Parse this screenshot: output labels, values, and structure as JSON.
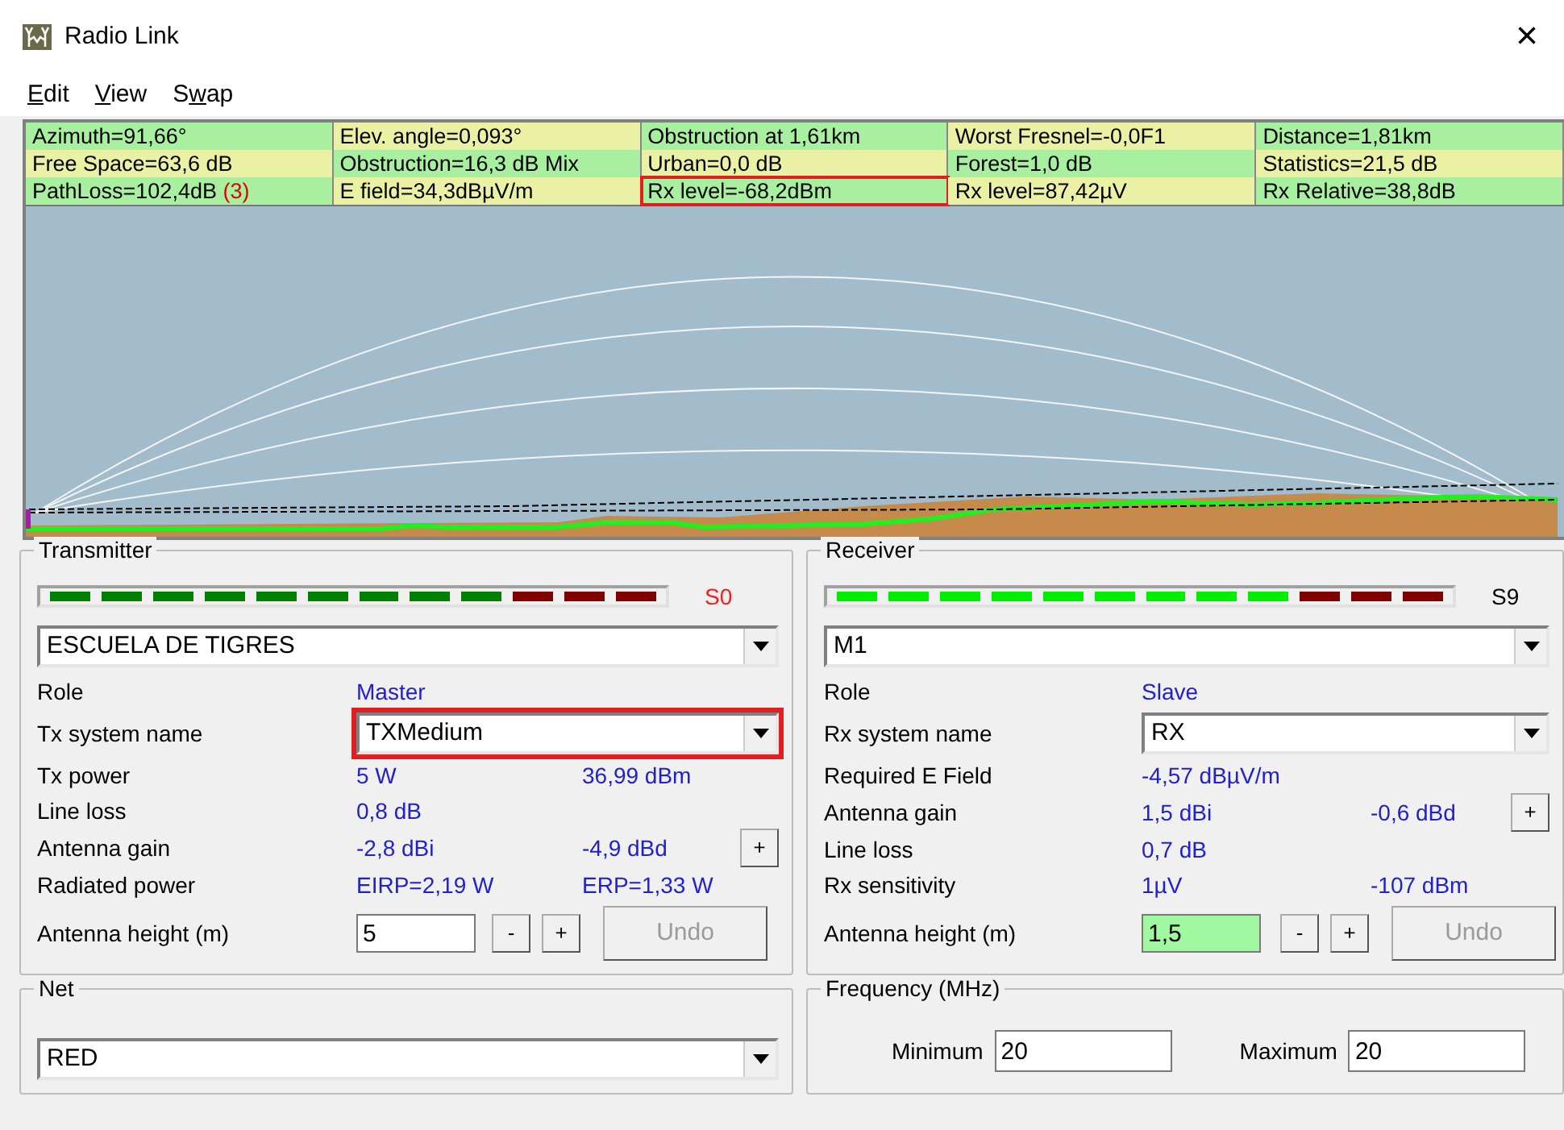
{
  "window": {
    "title": "Radio Link",
    "close": "×"
  },
  "menu": [
    {
      "access_key": "E",
      "rest": "dit"
    },
    {
      "access_key": "V",
      "rest": "iew"
    },
    {
      "before": "S",
      "access_key": "w",
      "rest": "ap"
    }
  ],
  "info": [
    [
      {
        "text": "Azimuth=91,66°",
        "highlighted": false
      },
      {
        "text": "Elev. angle=0,093°",
        "highlighted": false
      },
      {
        "text": "Obstruction at 1,61km",
        "highlighted": false
      },
      {
        "text": "Worst Fresnel=-0,0F1",
        "highlighted": false
      },
      {
        "text": "Distance=1,81km",
        "highlighted": false
      }
    ],
    [
      {
        "text": "Free Space=63,6 dB",
        "highlighted": false
      },
      {
        "text": "Obstruction=16,3 dB Mix",
        "highlighted": false
      },
      {
        "text": "Urban=0,0 dB",
        "highlighted": false
      },
      {
        "text": "Forest=1,0 dB",
        "highlighted": false
      },
      {
        "text": "Statistics=21,5 dB",
        "highlighted": false
      }
    ],
    [
      {
        "text": "PathLoss=102,4dB",
        "note": "(3)",
        "highlighted": false
      },
      {
        "text": "E field=34,3dBµV/m",
        "highlighted": false
      },
      {
        "text": "Rx level=-68,2dBm",
        "highlighted": true
      },
      {
        "text": "Rx level=87,42µV",
        "highlighted": false
      },
      {
        "text": "Rx Relative=38,8dB",
        "highlighted": false
      }
    ]
  ],
  "transmitter": {
    "title": "Transmitter",
    "meter": {
      "lit": false,
      "reading": "S0",
      "alert": true
    },
    "station": "ESCUELA DE TIGRES",
    "rows": [
      {
        "kind": "text",
        "label": "Role",
        "value": "Master"
      },
      {
        "kind": "select",
        "label": "Tx system name",
        "value": "TXMedium",
        "highlighted": true
      },
      {
        "kind": "text",
        "label": "Tx power",
        "value": "5 W",
        "value2": "36,99 dBm"
      },
      {
        "kind": "text",
        "label": "Line loss",
        "value": "0,8 dB"
      },
      {
        "kind": "gain",
        "label": "Antenna gain",
        "value": "-2,8 dBi",
        "value2": "-4,9 dBd",
        "button": "+"
      },
      {
        "kind": "text",
        "label": "Radiated power",
        "value": "EIRP=2,19 W",
        "value2": "ERP=1,33 W"
      },
      {
        "kind": "height",
        "label": "Antenna height (m)",
        "value": "5",
        "modified": false,
        "minus": "-",
        "plus": "+",
        "undo": "Undo",
        "disabled": true
      }
    ]
  },
  "receiver": {
    "title": "Receiver",
    "meter": {
      "lit": true,
      "reading": "S9",
      "alert": false
    },
    "station": "M1",
    "rows": [
      {
        "kind": "text",
        "label": "Role",
        "value": "Slave"
      },
      {
        "kind": "select",
        "label": "Rx system name",
        "value": "RX",
        "highlighted": false
      },
      {
        "kind": "text",
        "label": "Required E Field",
        "value": "-4,57 dBµV/m"
      },
      {
        "kind": "gain",
        "label": "Antenna gain",
        "value": "1,5 dBi",
        "value2": "-0,6 dBd",
        "button": "+"
      },
      {
        "kind": "text",
        "label": "Line loss",
        "value": "0,7 dB"
      },
      {
        "kind": "text",
        "label": "Rx sensitivity",
        "value": "1µV",
        "value2": "-107 dBm"
      },
      {
        "kind": "height",
        "label": "Antenna height (m)",
        "value": "1,5",
        "modified": true,
        "minus": "-",
        "plus": "+",
        "undo": "Undo",
        "disabled": true
      }
    ]
  },
  "net": {
    "title": "Net",
    "value": "RED"
  },
  "frequency": {
    "title": "Frequency (MHz)",
    "minimum_label": "Minimum",
    "minimum": "20",
    "maximum_label": "Maximum",
    "maximum": "20"
  }
}
